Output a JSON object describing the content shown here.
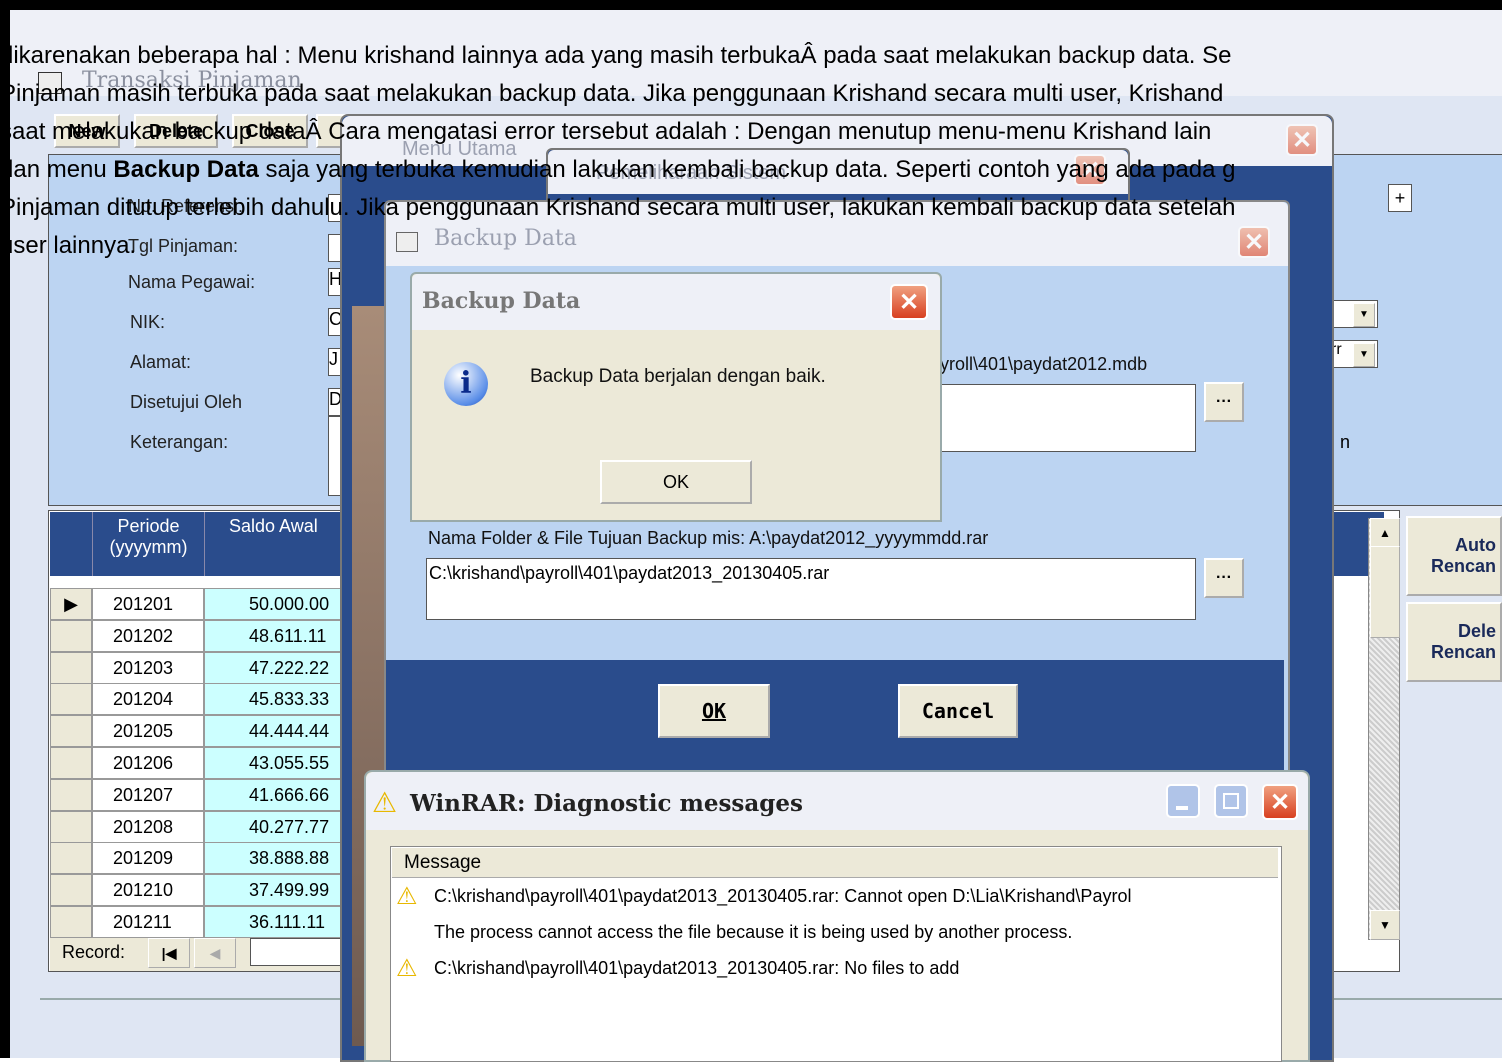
{
  "overlay_text": {
    "line1": "dikarenakan beberapa hal :  Menu krishand lainnya ada yang masih terbukaÂ pada saat melakukan backup data. Se",
    "line2": "Pinjaman masih terbuka pada saat melakukan backup data. Jika penggunaan Krishand secara multi user, Krishand",
    "line3": "saat melakukan backup dataÂ  Cara mengatasi error tersebut adalah :  Dengan menutup menu-menu Krishand lain",
    "line4a": "dan menu ",
    "line4b": "Backup Data",
    "line4c": " saja yang terbuka kemudian lakukan kembali backup data. Seperti contoh yang ada pada g",
    "line5": "Pinjaman ditutup terlebih dahulu. Jika penggunaan Krishand secara multi user, lakukan kembali backup data setelah",
    "line6": "user lainnya."
  },
  "transaksi": {
    "title": "Transaksi Pinjaman",
    "toolbar": {
      "new": "New",
      "delete": "Delete",
      "close": "Close"
    },
    "labels": {
      "no_ref": "No. Referensi:",
      "tgl": "Tgl Pinjaman:",
      "nama": "Nama Pegawai:",
      "nik": "NIK:",
      "alamat": "Alamat:",
      "disetujui": "Disetujui Oleh",
      "keterangan": "Keterangan:"
    },
    "field_values": {
      "nama": "H",
      "nik": "C",
      "alamat": "J",
      "disetujui": "D"
    },
    "right_combo_value": "rr",
    "right_label": "n",
    "grid_headers": {
      "periode": "Periode (yyyymm)",
      "saldo": "Saldo Awal"
    },
    "rows": [
      {
        "periode": "201201",
        "saldo": "50.000.00"
      },
      {
        "periode": "201202",
        "saldo": "48.611.11"
      },
      {
        "periode": "201203",
        "saldo": "47.222.22"
      },
      {
        "periode": "201204",
        "saldo": "45.833.33"
      },
      {
        "periode": "201205",
        "saldo": "44.444.44"
      },
      {
        "periode": "201206",
        "saldo": "43.055.55"
      },
      {
        "periode": "201207",
        "saldo": "41.666.66"
      },
      {
        "periode": "201208",
        "saldo": "40.277.77"
      },
      {
        "periode": "201209",
        "saldo": "38.888.88"
      },
      {
        "periode": "201210",
        "saldo": "37.499.99"
      },
      {
        "periode": "201211",
        "saldo": "36.111.11"
      }
    ],
    "record_label": "Record:",
    "side_buttons": {
      "auto": "Auto\nRencan",
      "dele": "Dele\nRencan"
    }
  },
  "menu_utama": {
    "title": "Menu Utama"
  },
  "pemeliharaan": {
    "title": "Pemeliharaan Sistem"
  },
  "backup_window": {
    "title": "Backup Data",
    "source_path_tail": "yroll\\401\\paydat2012.mdb",
    "dest_label": "Nama Folder & File Tujuan Backup mis: A:\\paydat2012_yyyymmdd.rar",
    "dest_value": "C:\\krishand\\payroll\\401\\paydat2013_20130405.rar",
    "ok": "OK",
    "cancel": "Cancel"
  },
  "msgbox": {
    "title": "Backup Data",
    "message": "Backup Data berjalan dengan baik.",
    "ok": "OK"
  },
  "winrar": {
    "title": "WinRAR: Diagnostic messages",
    "column": "Message",
    "messages": [
      "C:\\krishand\\payroll\\401\\paydat2013_20130405.rar: Cannot open D:\\Lia\\Krishand\\Payrol",
      "The process cannot access the file because it is being used by another process.",
      "C:\\krishand\\payroll\\401\\paydat2013_20130405.rar: No files to add"
    ]
  },
  "colors": {
    "xp_blue": "#0a50d8",
    "form_bg": "#bcd4f2",
    "access_blue": "#2a4c8c",
    "grid_cyan": "#ccffff"
  }
}
